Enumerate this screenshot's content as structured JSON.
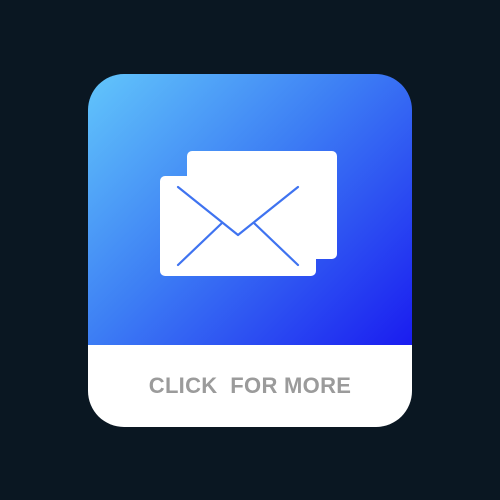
{
  "app_tile": {
    "icon": "mail-icon",
    "gradient_colors": [
      "#62c6fb",
      "#3d7ef4",
      "#1a1cf0"
    ],
    "footer_background": "#ffffff",
    "cta_label": "CLICK  FOR MORE",
    "cta_color": "#9b9b9b"
  },
  "background_color": "#0a1722"
}
